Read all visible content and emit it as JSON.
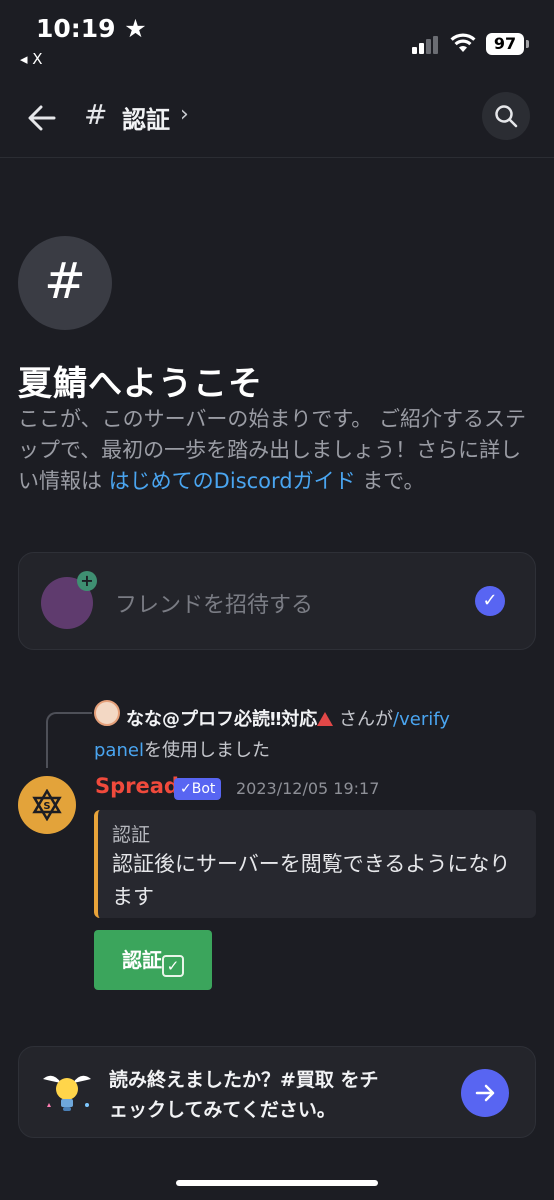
{
  "status_bar": {
    "time": "10:19 ★",
    "back_app": "◂ X",
    "battery": "97"
  },
  "header": {
    "hash": "#",
    "channel_name": "認証",
    "chevron": "›",
    "back_icon": "arrow-left-icon",
    "search_icon": "search-icon"
  },
  "welcome": {
    "icon_glyph": "#",
    "title": "夏鯖へようこそ",
    "text_before": "ここが、このサーバーの始まりです。 ご紹介するステップで、最初の一歩を踏み出しましょう！さらに詳しい情報は ",
    "link": "はじめてのDiscordガイド",
    "text_after": " まで。"
  },
  "invite_card": {
    "label": "フレンドを招待する",
    "plus": "+",
    "check": "✓"
  },
  "reply": {
    "username": "なな@プロフ必読‼対応",
    "suffix": " さんが",
    "command_part1": "/verify",
    "command_part2": "panel",
    "suffix2": "を使用しました"
  },
  "message": {
    "author": "Spread",
    "bot_tag": "✓Bot",
    "timestamp": "2023/12/05 19:17",
    "embed_title": "認証",
    "embed_description": "認証後にサーバーを閲覧できるようになります",
    "button_label": "認証",
    "button_emoji": "✓"
  },
  "banner": {
    "text": "読み終えましたか？#買取 をチェックしてみてください。"
  },
  "colors": {
    "background": "#1c1d23",
    "accent": "#5865f2",
    "link": "#4aa5f0",
    "author": "#f04a3c",
    "embed_bar": "#e9a43a",
    "button_green": "#3ba55c"
  }
}
